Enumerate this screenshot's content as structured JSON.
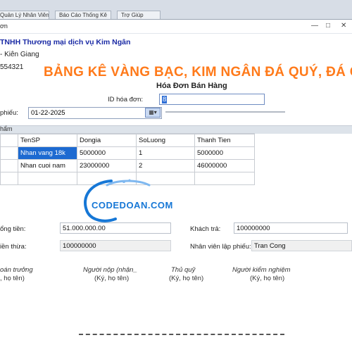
{
  "background_tabs": [
    "Quản Lý Nhân Viên",
    "Báo Cáo Thống Kê",
    "Trợ Giúp"
  ],
  "window": {
    "title": "ơn",
    "controls": [
      "minimize-icon",
      "maximize-icon",
      "close-icon"
    ]
  },
  "company": {
    "name": "TNHH Thương mại dịch vụ Kim Ngân",
    "address": "- Kiên Giang",
    "phone": "554321"
  },
  "report_title": "BẢNG KÊ VÀNG BẠC, KIM NGÂN ĐÁ QUÝ, ĐÁ C",
  "invoice_title": "Hóa Đơn Bán Hàng",
  "invoice_id": {
    "label": "ID hóa đơn:",
    "value": "8"
  },
  "date": {
    "label": "phiếu:",
    "value": "01-22-2025",
    "button": "calendar-icon"
  },
  "products_group_label": "hẩm",
  "grid": {
    "columns": [
      "TenSP",
      "Dongia",
      "SoLuong",
      "Thanh Tien"
    ],
    "rows": [
      [
        "Nhan vang 18k",
        "5000000",
        "1",
        "5000000"
      ],
      [
        "Nhan cuoi nam",
        "23000000",
        "2",
        "46000000"
      ]
    ]
  },
  "totals": {
    "total_label": "ổng tiền:",
    "total_value": "51.000.000.00",
    "change_label": "iền thừa:",
    "change_value": "100000000",
    "customer_pay_label": "Khách trả:",
    "customer_pay_value": "100000000",
    "staff_label": "Nhân viên lập phiếu:",
    "staff_value": "Tran Cong"
  },
  "signatures": [
    {
      "title": "oán trưởng",
      "note": ", họ tên)"
    },
    {
      "title": "Người nộp (nhận_",
      "note": "(Ký, họ tên)"
    },
    {
      "title": "Thủ quỹ",
      "note": "(Ký, họ tên)"
    },
    {
      "title": "Người kiểm nghiệm",
      "note": "(Ký, họ tên)"
    }
  ],
  "watermark_text": "CODEDOAN.COM",
  "colors": {
    "title_orange": "#ff7a1a",
    "company_blue": "#1a2aa5",
    "selection_blue": "#1d6ad1"
  }
}
